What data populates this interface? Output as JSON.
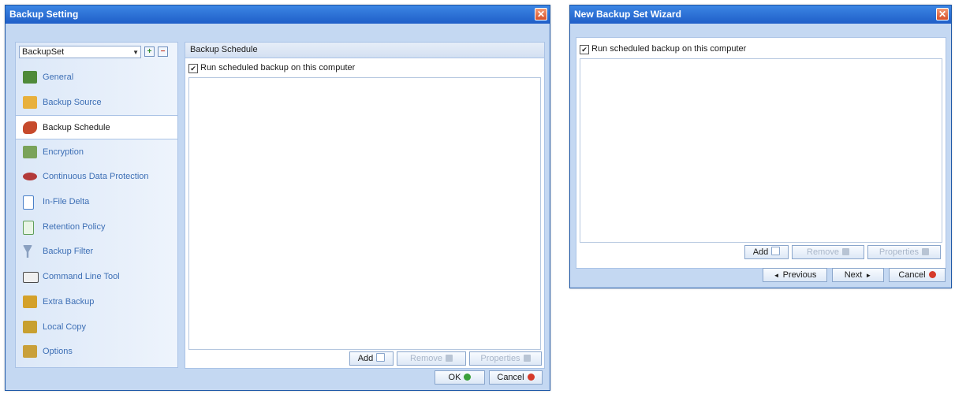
{
  "backup_setting": {
    "title": "Backup Setting",
    "close_glyph": "✕",
    "set_select": {
      "value": "BackupSet",
      "add_glyph": "+",
      "remove_glyph": "−"
    },
    "nav": [
      {
        "label": "General",
        "icon": "general-icon",
        "color": "#4f8a3a"
      },
      {
        "label": "Backup Source",
        "icon": "backup-source-icon",
        "color": "#e8b03c"
      },
      {
        "label": "Backup Schedule",
        "icon": "backup-schedule-icon",
        "color": "#c64a2c"
      },
      {
        "label": "Encryption",
        "icon": "encryption-icon",
        "color": "#7aa35a"
      },
      {
        "label": "Continuous Data Protection",
        "icon": "cdp-icon",
        "color": "#b33a3a"
      },
      {
        "label": "In-File Delta",
        "icon": "in-file-delta-icon",
        "color": "#4a80c8"
      },
      {
        "label": "Retention Policy",
        "icon": "retention-policy-icon",
        "color": "#5f9f5a"
      },
      {
        "label": "Backup Filter",
        "icon": "backup-filter-icon",
        "color": "#8aa0c0"
      },
      {
        "label": "Command Line Tool",
        "icon": "command-line-tool-icon",
        "color": "#4a4a4a"
      },
      {
        "label": "Extra Backup",
        "icon": "extra-backup-icon",
        "color": "#d4a12a"
      },
      {
        "label": "Local Copy",
        "icon": "local-copy-icon",
        "color": "#c8a030"
      },
      {
        "label": "Options",
        "icon": "options-icon",
        "color": "#c9a03a"
      }
    ],
    "active_nav": "Backup Schedule",
    "panel_header": "Backup Schedule",
    "run_scheduled_label": "Run scheduled backup on this computer",
    "run_scheduled_checked": true,
    "buttons": {
      "add": "Add",
      "remove": "Remove",
      "properties": "Properties",
      "ok": "OK",
      "cancel": "Cancel"
    }
  },
  "wizard": {
    "title": "New Backup Set Wizard",
    "close_glyph": "✕",
    "run_scheduled_label": "Run scheduled backup on this computer",
    "run_scheduled_checked": true,
    "buttons": {
      "add": "Add",
      "remove": "Remove",
      "properties": "Properties",
      "previous": "Previous",
      "next": "Next",
      "cancel": "Cancel"
    }
  },
  "colors": {
    "title_bar": "#2a6fd6",
    "window_body": "#c4d8f2",
    "close": "#e06a40",
    "ok_icon": "#3aa03a",
    "cancel_icon": "#d63a2a"
  }
}
